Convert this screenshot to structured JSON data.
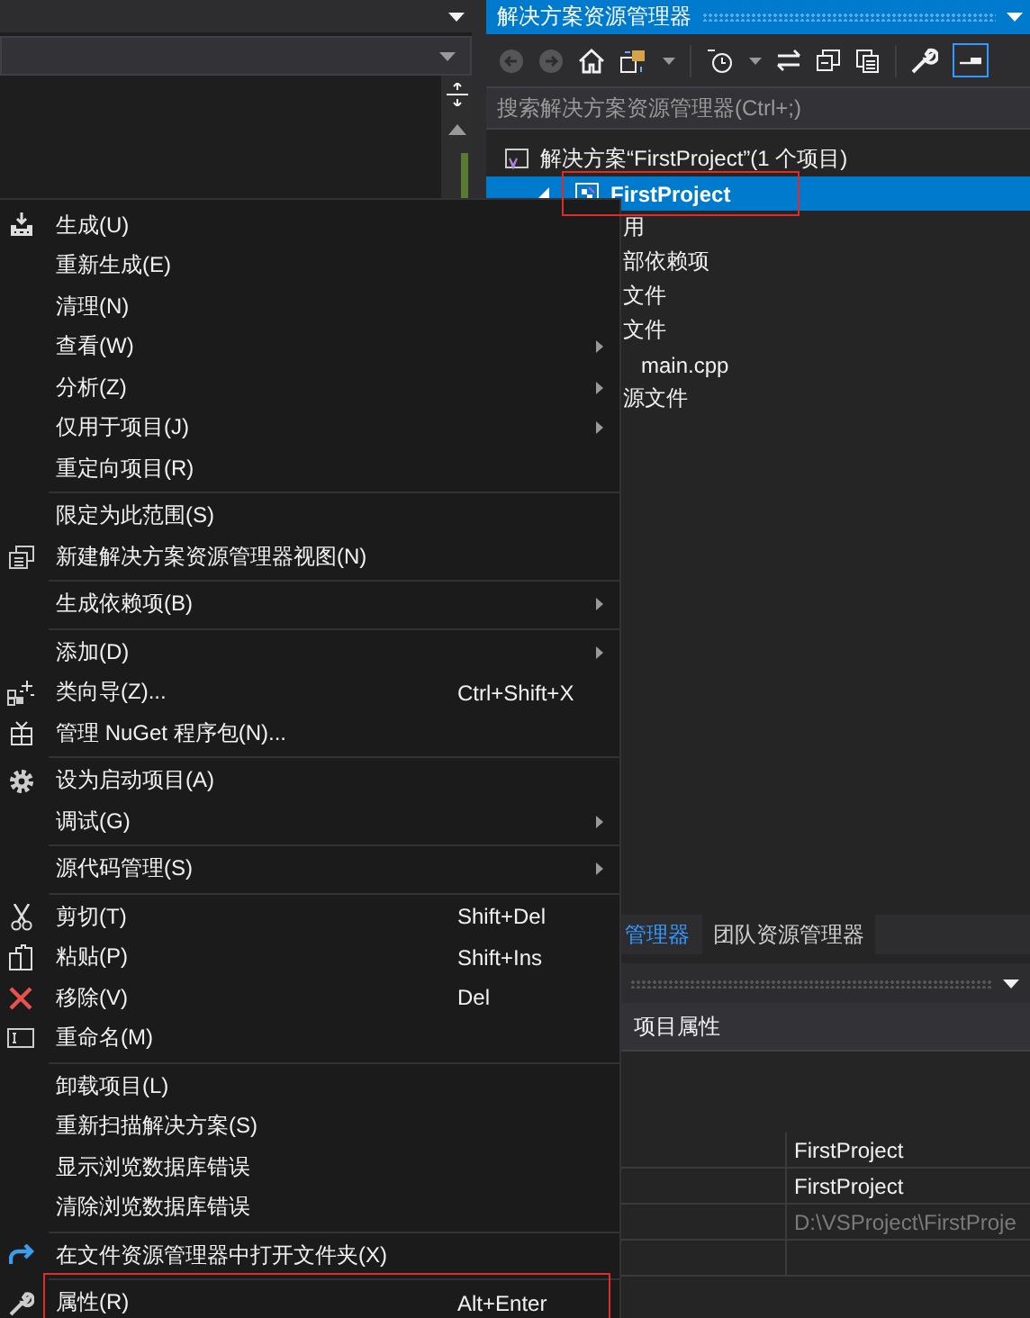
{
  "solution_explorer": {
    "title": "解决方案资源管理器",
    "search": {
      "placeholder": "搜索解决方案资源管理器(Ctrl+;)"
    },
    "tree": [
      {
        "label": "解决方案“FirstProject”(1 个项目)",
        "selected": false,
        "children": [
          {
            "label": "FirstProject",
            "selected": true,
            "annotated": true,
            "expanded": true,
            "children": [
              {
                "label": "用",
                "selected": false
              },
              {
                "label": "部依赖项",
                "selected": false
              },
              {
                "label": "文件",
                "selected": false
              },
              {
                "label": "文件",
                "selected": false,
                "children": [
                  {
                    "label": "main.cpp",
                    "selected": false
                  }
                ]
              },
              {
                "label": "源文件",
                "selected": false
              }
            ]
          }
        ]
      }
    ]
  },
  "bottom_tabs": [
    {
      "label": "管理器",
      "selected": true
    },
    {
      "label": "团队资源管理器",
      "selected": false
    }
  ],
  "properties": {
    "title": "项目属性",
    "rows": [
      {
        "value": "FirstProject",
        "disabled": false
      },
      {
        "value": "FirstProject",
        "disabled": false
      },
      {
        "value": "D:\\VSProject\\FirstProje",
        "disabled": true
      }
    ]
  },
  "context_menu": {
    "items": [
      {
        "kind": "item",
        "label": "生成(U)"
      },
      {
        "kind": "item",
        "label": "重新生成(E)"
      },
      {
        "kind": "item",
        "label": "清理(N)"
      },
      {
        "kind": "item",
        "label": "查看(W)",
        "submenu": true
      },
      {
        "kind": "item",
        "label": "分析(Z)",
        "submenu": true
      },
      {
        "kind": "item",
        "label": "仅用于项目(J)",
        "submenu": true
      },
      {
        "kind": "item",
        "label": "重定向项目(R)"
      },
      {
        "kind": "separator"
      },
      {
        "kind": "item",
        "label": "限定为此范围(S)"
      },
      {
        "kind": "item",
        "label": "新建解决方案资源管理器视图(N)"
      },
      {
        "kind": "separator"
      },
      {
        "kind": "item",
        "label": "生成依赖项(B)",
        "submenu": true
      },
      {
        "kind": "separator"
      },
      {
        "kind": "item",
        "label": "添加(D)",
        "submenu": true
      },
      {
        "kind": "item",
        "label": "类向导(Z)...",
        "shortcut": "Ctrl+Shift+X"
      },
      {
        "kind": "item",
        "label": "管理 NuGet 程序包(N)..."
      },
      {
        "kind": "separator"
      },
      {
        "kind": "item",
        "label": "设为启动项目(A)"
      },
      {
        "kind": "item",
        "label": "调试(G)",
        "submenu": true
      },
      {
        "kind": "separator"
      },
      {
        "kind": "item",
        "label": "源代码管理(S)",
        "submenu": true
      },
      {
        "kind": "separator"
      },
      {
        "kind": "item",
        "label": "剪切(T)",
        "shortcut": "Shift+Del"
      },
      {
        "kind": "item",
        "label": "粘贴(P)",
        "shortcut": "Shift+Ins"
      },
      {
        "kind": "item",
        "label": "移除(V)",
        "shortcut": "Del"
      },
      {
        "kind": "item",
        "label": "重命名(M)"
      },
      {
        "kind": "separator"
      },
      {
        "kind": "item",
        "label": "卸载项目(L)"
      },
      {
        "kind": "item",
        "label": "重新扫描解决方案(S)"
      },
      {
        "kind": "item",
        "label": "显示浏览数据库错误"
      },
      {
        "kind": "item",
        "label": "清除浏览数据库错误"
      },
      {
        "kind": "separator"
      },
      {
        "kind": "item",
        "label": "在文件资源管理器中打开文件夹(X)"
      },
      {
        "kind": "separator"
      },
      {
        "kind": "item",
        "label": "属性(R)",
        "shortcut": "Alt+Enter",
        "annotated": true
      }
    ]
  }
}
